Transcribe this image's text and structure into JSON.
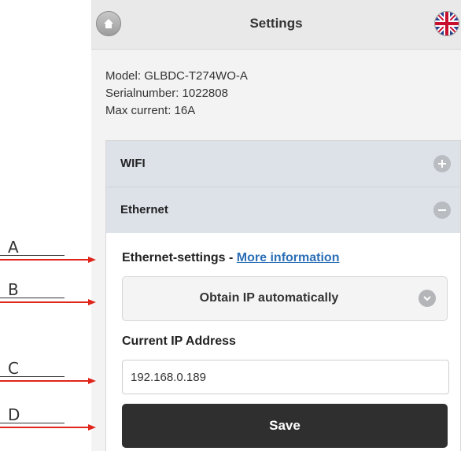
{
  "header": {
    "title": "Settings",
    "home_icon": "home-icon",
    "language_icon": "uk-flag-icon"
  },
  "device_info": {
    "model": "Model: GLBDC-T274WO-A",
    "serial": "Serialnumber: 1022808",
    "max_current": "Max current: 16A"
  },
  "accordion": {
    "wifi_label": "WIFI",
    "ethernet_label": "Ethernet"
  },
  "ethernet": {
    "heading": "Ethernet-settings - ",
    "more_info": "More information",
    "ip_mode": "Obtain IP automatically",
    "current_ip_label": "Current IP Address",
    "current_ip_value": "192.168.0.189",
    "save_label": "Save"
  },
  "callouts": [
    "A",
    "B",
    "C",
    "D"
  ],
  "colors": {
    "accent_arrow": "#e0251b",
    "save_button": "#2f2f2f",
    "link": "#2b6fb6"
  }
}
